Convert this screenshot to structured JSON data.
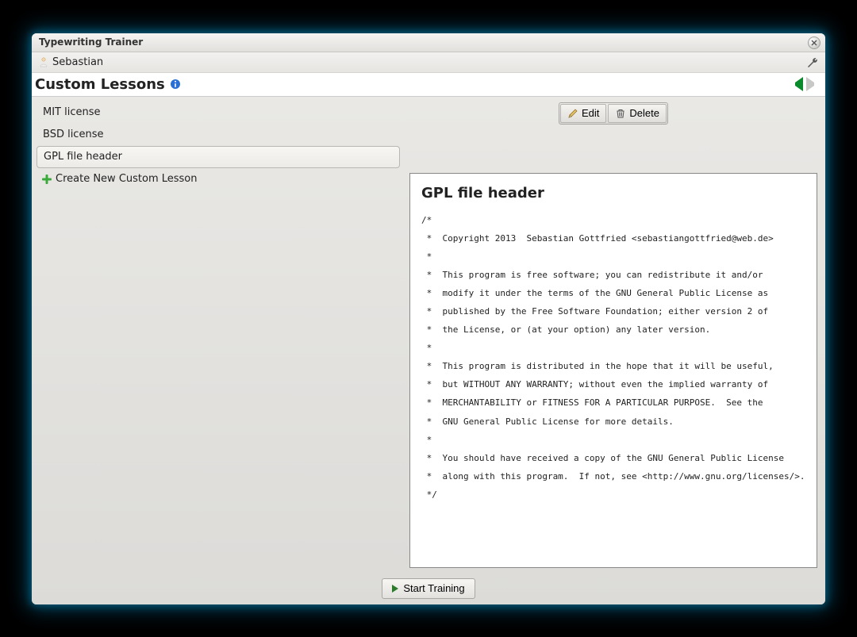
{
  "window": {
    "title": "Typewriting Trainer"
  },
  "user": {
    "name": "Sebastian"
  },
  "header": {
    "title": "Custom Lessons"
  },
  "lessons": [
    {
      "label": "MIT license",
      "selected": false
    },
    {
      "label": "BSD license",
      "selected": false
    },
    {
      "label": "GPL file header",
      "selected": true
    }
  ],
  "create": {
    "label": "Create New Custom Lesson"
  },
  "actions": {
    "edit": "Edit",
    "delete": "Delete"
  },
  "preview": {
    "title": "GPL file header",
    "body": "/*\n *  Copyright 2013  Sebastian Gottfried <sebastiangottfried@web.de>\n *\n *  This program is free software; you can redistribute it and/or\n *  modify it under the terms of the GNU General Public License as\n *  published by the Free Software Foundation; either version 2 of\n *  the License, or (at your option) any later version.\n *\n *  This program is distributed in the hope that it will be useful,\n *  but WITHOUT ANY WARRANTY; without even the implied warranty of\n *  MERCHANTABILITY or FITNESS FOR A PARTICULAR PURPOSE.  See the\n *  GNU General Public License for more details.\n *\n *  You should have received a copy of the GNU General Public License\n *  along with this program.  If not, see <http://www.gnu.org/licenses/>.\n */"
  },
  "footer": {
    "start": "Start Training"
  }
}
